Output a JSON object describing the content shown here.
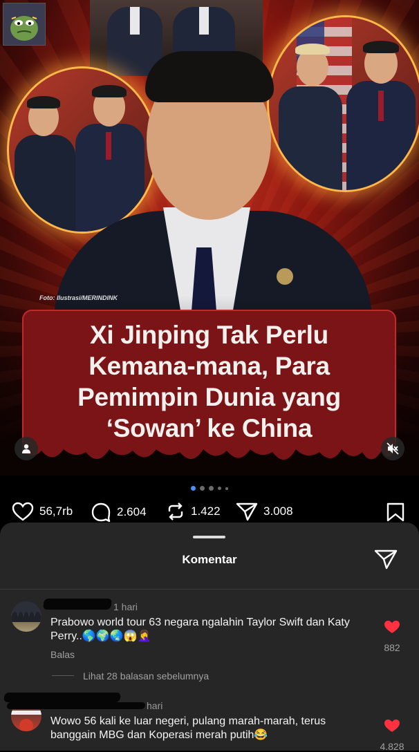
{
  "post": {
    "photo_credit": "Foto: Ilustrasi/MERINDINK",
    "headline_lines": [
      "Xi Jinping Tak Perlu",
      "Kemana-mana, Para",
      "Pemimpin Dunia yang",
      "‘Sowan’ ke China"
    ],
    "carousel": {
      "total": 5,
      "active": 1
    }
  },
  "actions": {
    "likes": "56,7rb",
    "comments": "2.604",
    "reposts": "1.422",
    "shares": "3.008"
  },
  "comments_sheet": {
    "title": "Komentar",
    "items": [
      {
        "time": "1 hari",
        "text": "Prabowo world tour 63 negara ngalahin Taylor Swift dan Katy Perry..🌎🌍🌏😱🤦‍♀️",
        "reply_label": "Balas",
        "likes": "882",
        "view_replies": "Lihat 28 balasan sebelumnya"
      },
      {
        "time": "hari",
        "text": "Wowo 56 kali ke luar negeri, pulang marah-marah, terus banggain MBG dan Koperasi merah putih😂",
        "likes": "4.828"
      }
    ]
  },
  "colors": {
    "accent_like": "#ff3040",
    "carousel_active": "#4a90f5",
    "headline_bg": "#7a1416"
  }
}
